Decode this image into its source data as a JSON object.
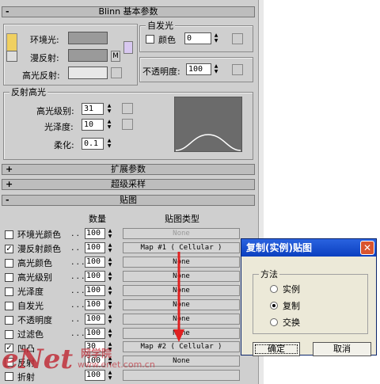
{
  "rollouts": {
    "blinn": {
      "sign": "-",
      "title": "Blinn 基本参数"
    },
    "extended": {
      "sign": "+",
      "title": "扩展参数"
    },
    "supersampling": {
      "sign": "+",
      "title": "超级采样"
    },
    "maps": {
      "sign": "-",
      "title": "贴图"
    }
  },
  "basic": {
    "ambient_label": "环境光:",
    "diffuse_label": "漫反射:",
    "specular_label": "高光反射:",
    "lock_m": "M",
    "ambient_color": "#9a9a9a",
    "diffuse_color": "#9a9a9a",
    "specular_color": "#e8e8e8"
  },
  "self_illum": {
    "group_label": "自发光",
    "color_label": "颜色",
    "value": "0",
    "opacity_label": "不透明度:",
    "opacity_value": "100"
  },
  "specular_highlights": {
    "group_label": "反射高光",
    "level_label": "高光级别:",
    "level_value": "31",
    "gloss_label": "光泽度:",
    "gloss_value": "10",
    "soften_label": "柔化:",
    "soften_value": "0.1"
  },
  "maps": {
    "amount_header": "数量",
    "type_header": "贴图类型",
    "rows": [
      {
        "checked": false,
        "check_mark": "",
        "label": "环境光颜色",
        "dots": "..",
        "amount": "100",
        "map": "None"
      },
      {
        "checked": true,
        "check_mark": "✓",
        "label": "漫反射颜色",
        "dots": "..",
        "amount": "100",
        "map": "Map #1  ( Cellular )"
      },
      {
        "checked": false,
        "check_mark": "",
        "label": "高光颜色",
        "dots": "...",
        "amount": "100",
        "map": "None"
      },
      {
        "checked": false,
        "check_mark": "",
        "label": "高光级别",
        "dots": "...",
        "amount": "100",
        "map": "None"
      },
      {
        "checked": false,
        "check_mark": "",
        "label": "光泽度",
        "dots": "....",
        "amount": "100",
        "map": "None"
      },
      {
        "checked": false,
        "check_mark": "",
        "label": "自发光",
        "dots": "....",
        "amount": "100",
        "map": "None"
      },
      {
        "checked": false,
        "check_mark": "",
        "label": "不透明度",
        "dots": "..",
        "amount": "100",
        "map": "None"
      },
      {
        "checked": false,
        "check_mark": "",
        "label": "过滤色",
        "dots": "....",
        "amount": "100",
        "map": "None"
      },
      {
        "checked": true,
        "check_mark": "✓",
        "label": "凹凸",
        "dots": "",
        "amount": "30",
        "map": "Map #2  ( Cellular )"
      },
      {
        "checked": false,
        "check_mark": "",
        "label": "反射",
        "dots": "",
        "amount": "100",
        "map": "None"
      },
      {
        "checked": false,
        "check_mark": "",
        "label": "折射",
        "dots": "",
        "amount": "100",
        "map": ""
      }
    ]
  },
  "dialog": {
    "title": "复制(实例)贴图",
    "close": "✕",
    "group_label": "方法",
    "options": [
      {
        "label": "实例",
        "selected": false
      },
      {
        "label": "复制",
        "selected": true
      },
      {
        "label": "交换",
        "selected": false
      }
    ],
    "ok": "确定",
    "cancel": "取消"
  },
  "watermark": {
    "text": "eNet",
    "sub": "网学院",
    "url": "www.enet.com.cn"
  }
}
